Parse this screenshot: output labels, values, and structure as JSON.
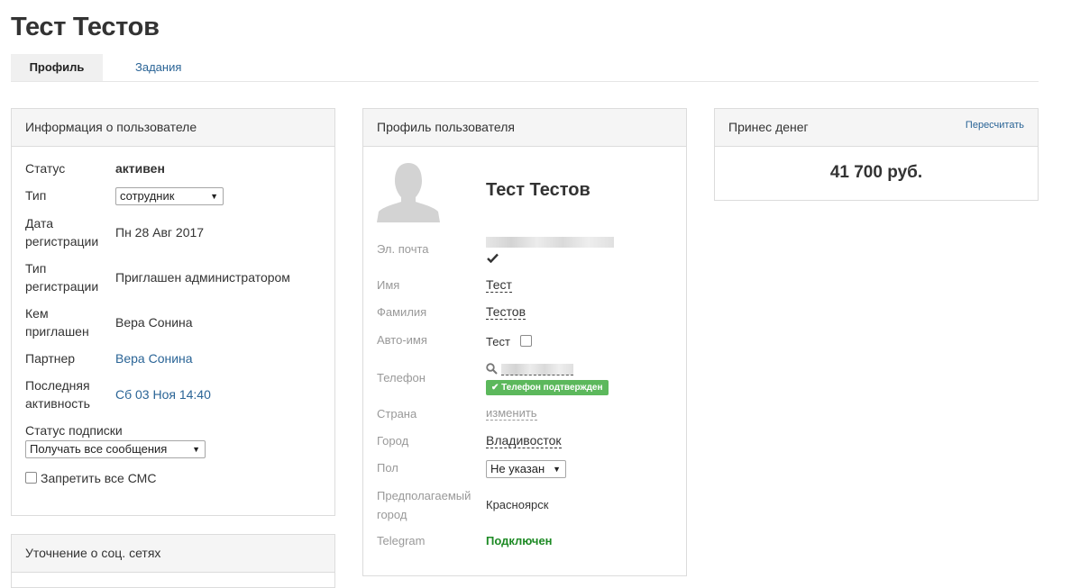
{
  "page": {
    "title": "Тест Тестов"
  },
  "tabs": {
    "profile": "Профиль",
    "tasks": "Задания"
  },
  "user_info": {
    "title": "Информация о пользователе",
    "status_label": "Статус",
    "status_value": "активен",
    "type_label": "Тип",
    "type_value": "сотрудник",
    "reg_date_label_1": "Дата",
    "reg_date_label_2": "регистрации",
    "reg_date_value": "Пн 28 Авг 2017",
    "reg_type_label_1": "Тип",
    "reg_type_label_2": "регистрации",
    "reg_type_value": "Приглашен администратором",
    "invited_by_label_1": "Кем",
    "invited_by_label_2": "приглашен",
    "invited_by_value": "Вера Сонина",
    "partner_label": "Партнер",
    "partner_value": "Вера Сонина",
    "last_activity_label_1": "Последняя",
    "last_activity_label_2": "активность",
    "last_activity_value": "Сб 03 Ноя 14:40",
    "subscription_label": "Статус подписки",
    "subscription_value": "Получать все сообщения",
    "block_sms_label": "Запретить все СМС"
  },
  "social_panel": {
    "title": "Уточнение о соц. сетях"
  },
  "user_profile": {
    "title": "Профиль пользователя",
    "name": "Тест Тестов",
    "email_label": "Эл. почта",
    "first_name_label": "Имя",
    "first_name_value": "Тест",
    "last_name_label": "Фамилия",
    "last_name_value": "Тестов",
    "auto_name_label": "Авто-имя",
    "auto_name_value": "Тест",
    "phone_label": "Телефон",
    "phone_verified": "Телефон подтвержден",
    "country_label": "Страна",
    "country_value": "изменить",
    "city_label": "Город",
    "city_value": "Владивосток",
    "gender_label": "Пол",
    "gender_value": "Не указан",
    "assumed_city_label_1": "Предполагаемый",
    "assumed_city_label_2": "город",
    "assumed_city_value": "Красноярск",
    "telegram_label": "Telegram",
    "telegram_value": "Подключен"
  },
  "money": {
    "title": "Принес денег",
    "recalc": "Пересчитать",
    "amount": "41 700 руб."
  },
  "icons": {
    "check": "check-icon",
    "search": "search-icon",
    "avatar": "avatar-silhouette"
  }
}
